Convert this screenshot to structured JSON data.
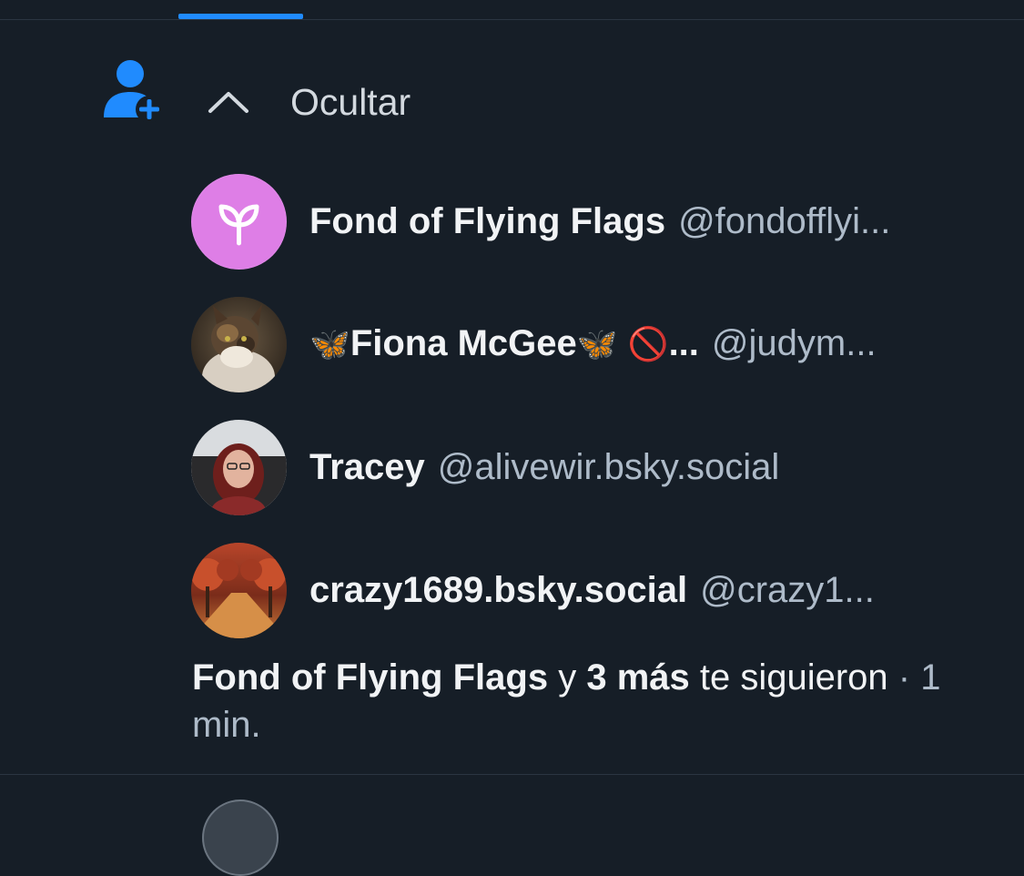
{
  "notification": {
    "hide_label": "Ocultar",
    "icons": {
      "follow": "person-add-icon",
      "collapse": "chevron-up-icon"
    },
    "followers": [
      {
        "name": "Fond of Flying Flags",
        "handle": "@fondofflyi...",
        "avatar": "seedling-icon"
      },
      {
        "name_prefix": "🦋",
        "name": "Fiona McGee",
        "name_suffix": "🦋",
        "name_extra": "🚫",
        "name_ellipsis": "...",
        "handle": "@judym...",
        "avatar": "cat-photo"
      },
      {
        "name": "Tracey",
        "handle": "@alivewir.bsky.social",
        "avatar": "woman-photo"
      },
      {
        "name": "crazy1689.bsky.social",
        "handle": "@crazy1...",
        "avatar": "autumn-path-photo"
      }
    ],
    "summary": {
      "lead_name": "Fond of Flying Flags",
      "connector": "y",
      "others": "3 más",
      "action": "te siguieron",
      "separator": "·",
      "time": "1 min."
    }
  },
  "colors": {
    "background": "#161e27",
    "accent": "#208bfe",
    "avatar_default": "#de7ee6",
    "handle_text": "#aebbc9"
  }
}
